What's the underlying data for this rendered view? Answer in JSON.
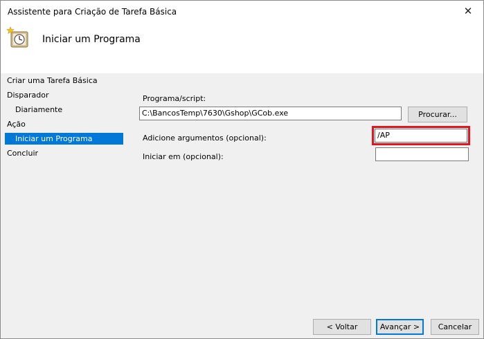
{
  "window": {
    "title": "Assistente para Criação de Tarefa Básica",
    "close_symbol": "✕"
  },
  "header": {
    "title": "Iniciar um Programa",
    "icon": "scheduled-task-clock-icon"
  },
  "sidebar": {
    "items": [
      {
        "label": "Criar uma Tarefa Básica"
      },
      {
        "label": "Disparador"
      },
      {
        "label": "Diariamente"
      },
      {
        "label": "Ação"
      },
      {
        "label": "Iniciar um Programa"
      },
      {
        "label": "Concluir"
      }
    ]
  },
  "form": {
    "program_label": "Programa/script:",
    "program_value": "C:\\BancosTemp\\7630\\Gshop\\GCob.exe",
    "browse_label": "Procurar...",
    "args_label": "Adicione argumentos (opcional):",
    "args_value": "/AP",
    "start_in_label": "Iniciar em (opcional):",
    "start_in_value": ""
  },
  "footer": {
    "back_label": "< Voltar",
    "next_label": "Avançar >",
    "cancel_label": "Cancelar"
  },
  "colors": {
    "accent": "#0078d7",
    "highlight": "#e0161e",
    "panel": "#f0f0f0"
  }
}
